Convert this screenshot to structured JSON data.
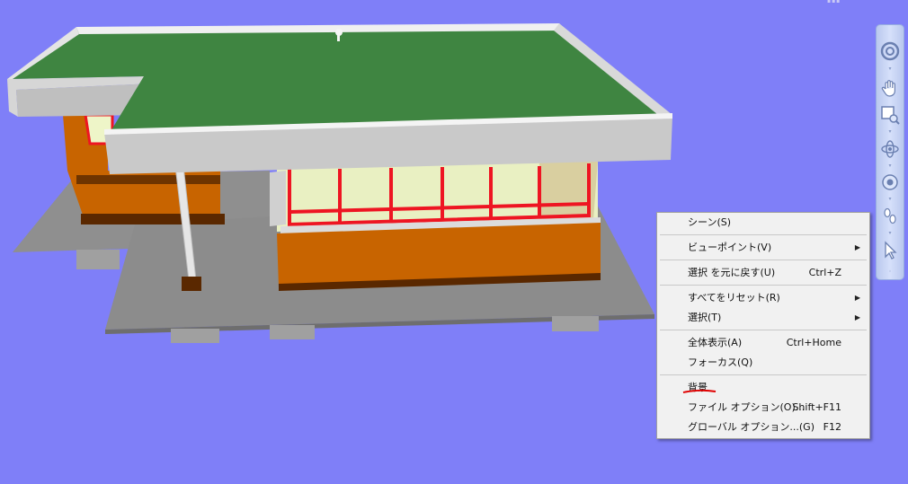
{
  "context_menu": {
    "scene": "シーン(S)",
    "viewpoint": "ビューポイント(V)",
    "undo_select": "選択 を元に戻す(U)",
    "undo_select_shortcut": "Ctrl+Z",
    "reset_all": "すべてをリセット(R)",
    "select": "選択(T)",
    "view_all": "全体表示(A)",
    "view_all_shortcut": "Ctrl+Home",
    "focus": "フォーカス(Q)",
    "background": "背景",
    "file_options": "ファイル オプション(O)...",
    "file_options_shortcut": "Shift+F11",
    "global_options": "グローバル オプション...(G)",
    "global_options_shortcut": "F12",
    "submenu_arrow": "▶"
  },
  "navigation_bar": {
    "tools": [
      "steering-wheel-icon",
      "pan-icon",
      "zoom-window-icon",
      "orbit-icon",
      "look-icon",
      "walk-icon",
      "select-icon"
    ]
  },
  "colors": {
    "viewport_background": "#7f7ff8",
    "roof": "#3f8541",
    "wall": "#c86400",
    "slab": "#8c8c8c",
    "window_frame": "#ee1522",
    "annotation_underline": "#e00000"
  }
}
